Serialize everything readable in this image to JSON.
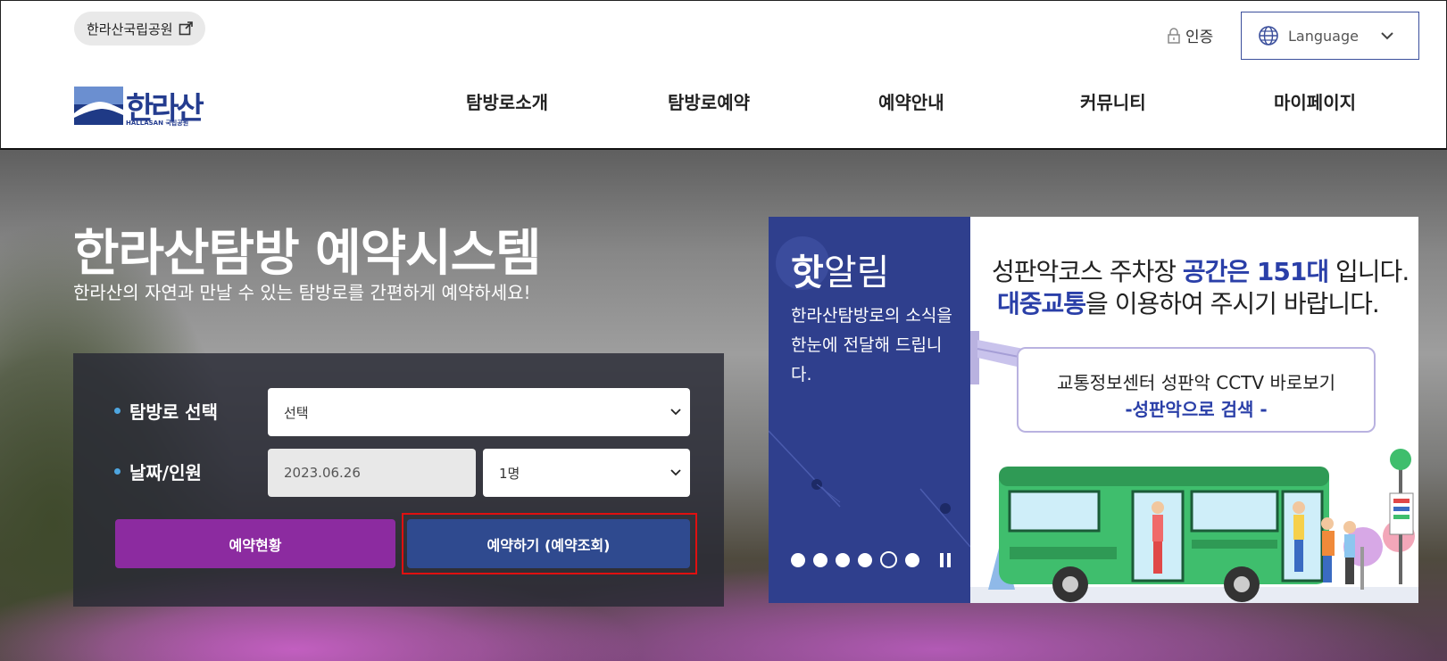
{
  "header": {
    "ext_link_label": "한라산국립공원",
    "auth_label": "인증",
    "language_label": "Language",
    "logo": {
      "text": "한라산",
      "subtitle": "HALLASAN 국립공원"
    },
    "nav": [
      "탐방로소개",
      "탐방로예약",
      "예약안내",
      "커뮤니티",
      "마이페이지"
    ]
  },
  "hero": {
    "title": "한라산탐방 예약시스템",
    "subtitle": "한라산의 자연과 만날 수 있는 탐방로를 간편하게 예약하세요!"
  },
  "form": {
    "trail_label": "탐방로 선택",
    "trail_value": "선택",
    "date_label": "날짜/인원",
    "date_value": "2023.06.26",
    "people_value": "1명",
    "status_button": "예약현황",
    "reserve_button": "예약하기 (예약조회)"
  },
  "notice": {
    "title_hot": "핫",
    "title_rest": "알림",
    "description": "한라산탐방로의 소식을 한눈에 전달해 드립니다.",
    "slide_count": 6,
    "active_slide": 5,
    "banner": {
      "line1_a": "성판악코스 주차장 ",
      "line1_hl": "공간은 151대",
      "line1_b": " 입니다.",
      "line2_hl": "대중교통",
      "line2_b": "을 이용하여 주시기 바랍니다.",
      "cctv_line1": "교통정보센터 성판악 CCTV 바로보기",
      "cctv_line2": "-성판악으로 검색 -"
    }
  },
  "colors": {
    "brand_navy": "#2f3f8d",
    "status_purple": "#8c2ba0",
    "highlight_red": "#e01010",
    "accent_blue": "#2a3fa8"
  }
}
